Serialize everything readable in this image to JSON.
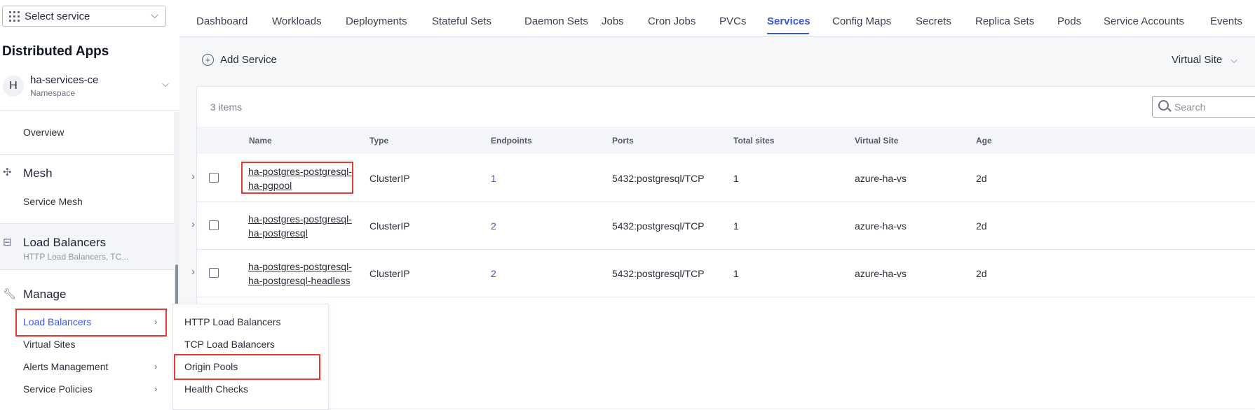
{
  "sidebar": {
    "service_select": "Select service",
    "app_title": "Distributed Apps",
    "namespace": {
      "avatar": "H",
      "name": "ha-services-ce",
      "label": "Namespace"
    },
    "overview": "Overview",
    "mesh": {
      "title": "Mesh",
      "item": "Service Mesh"
    },
    "load_balancers": {
      "title": "Load Balancers",
      "subtitle": "HTTP Load Balancers, TC..."
    },
    "manage": {
      "title": "Manage",
      "items": [
        "Load Balancers",
        "Virtual Sites",
        "Alerts Management",
        "Service Policies"
      ]
    }
  },
  "flyout": {
    "items": [
      "HTTP Load Balancers",
      "TCP Load Balancers",
      "Origin Pools",
      "Health Checks"
    ]
  },
  "tabs": [
    "Dashboard",
    "Workloads",
    "Deployments",
    "Stateful Sets",
    "Daemon Sets",
    "Jobs",
    "Cron Jobs",
    "PVCs",
    "Services",
    "Config Maps",
    "Secrets",
    "Replica Sets",
    "Pods",
    "Service Accounts",
    "Events"
  ],
  "active_tab": "Services",
  "toolbar": {
    "add_service": "Add Service",
    "virtual_site": "Virtual Site"
  },
  "table": {
    "count": "3 items",
    "search_placeholder": "Search",
    "columns": [
      "Name",
      "Type",
      "Endpoints",
      "Ports",
      "Total sites",
      "Virtual Site",
      "Age"
    ],
    "rows": [
      {
        "name_line1": "ha-postgres-postgresql-",
        "name_line2": "ha-pgpool",
        "type": "ClusterIP",
        "endpoints": "1",
        "ports": "5432:postgresql/TCP",
        "total_sites": "1",
        "virtual_site": "azure-ha-vs",
        "age": "2d"
      },
      {
        "name_line1": "ha-postgres-postgresql-",
        "name_line2": "ha-postgresql",
        "type": "ClusterIP",
        "endpoints": "2",
        "ports": "5432:postgresql/TCP",
        "total_sites": "1",
        "virtual_site": "azure-ha-vs",
        "age": "2d"
      },
      {
        "name_line1": "ha-postgres-postgresql-",
        "name_line2": "ha-postgresql-headless",
        "type": "ClusterIP",
        "endpoints": "2",
        "ports": "5432:postgresql/TCP",
        "total_sites": "1",
        "virtual_site": "azure-ha-vs",
        "age": "2d"
      }
    ]
  },
  "colors": {
    "accent": "#3b57d9",
    "highlight_box": "#e53935"
  }
}
